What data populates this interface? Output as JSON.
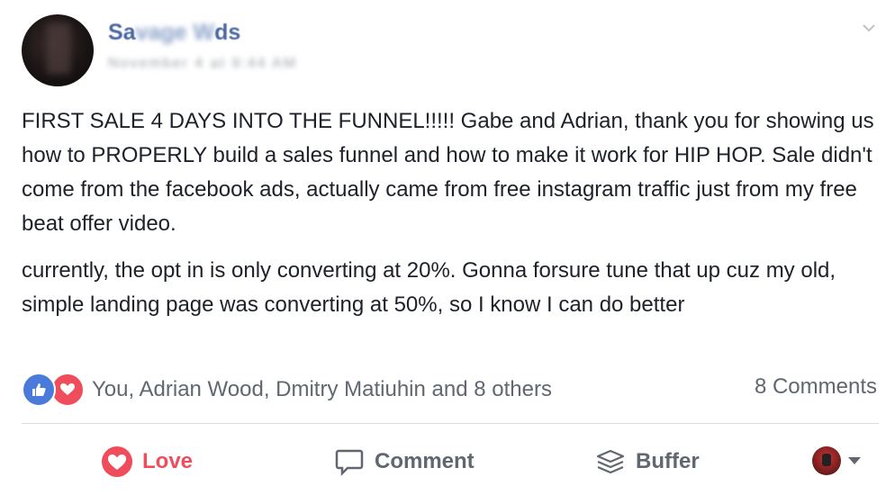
{
  "post": {
    "author": {
      "name_visible_start": "Sa",
      "name_blurred": "vage W",
      "name_visible_end": "ds"
    },
    "timestamp_blurred": "November 4 at 9:44 AM",
    "paragraphs": [
      "FIRST SALE 4 DAYS INTO THE FUNNEL!!!!! Gabe and Adrian, thank you for showing us how to PROPERLY build a sales funnel and how to make it work for HIP HOP. Sale didn't come from the facebook ads, actually came from free instagram traffic just from my free beat offer video.",
      "currently, the opt in is only converting at 20%. Gonna forsure tune that up cuz my old, simple landing page was converting at 50%, so I know I can do better"
    ],
    "reactions_text": "You, Adrian Wood, Dmitry Matiuhin and 8 others",
    "comments_count": "8 Comments"
  },
  "actions": {
    "love_label": "Love",
    "comment_label": "Comment",
    "buffer_label": "Buffer"
  },
  "icons": {
    "like": "like-icon",
    "love_reaction": "love-reaction-icon",
    "love": "heart-icon",
    "comment": "comment-bubble-icon",
    "buffer": "buffer-stack-icon",
    "menu": "chevron-down-icon"
  },
  "colors": {
    "author_link": "#4b67a1",
    "love": "#ef4d5b",
    "like": "#4a7bd8",
    "secondary_text": "#606770"
  }
}
